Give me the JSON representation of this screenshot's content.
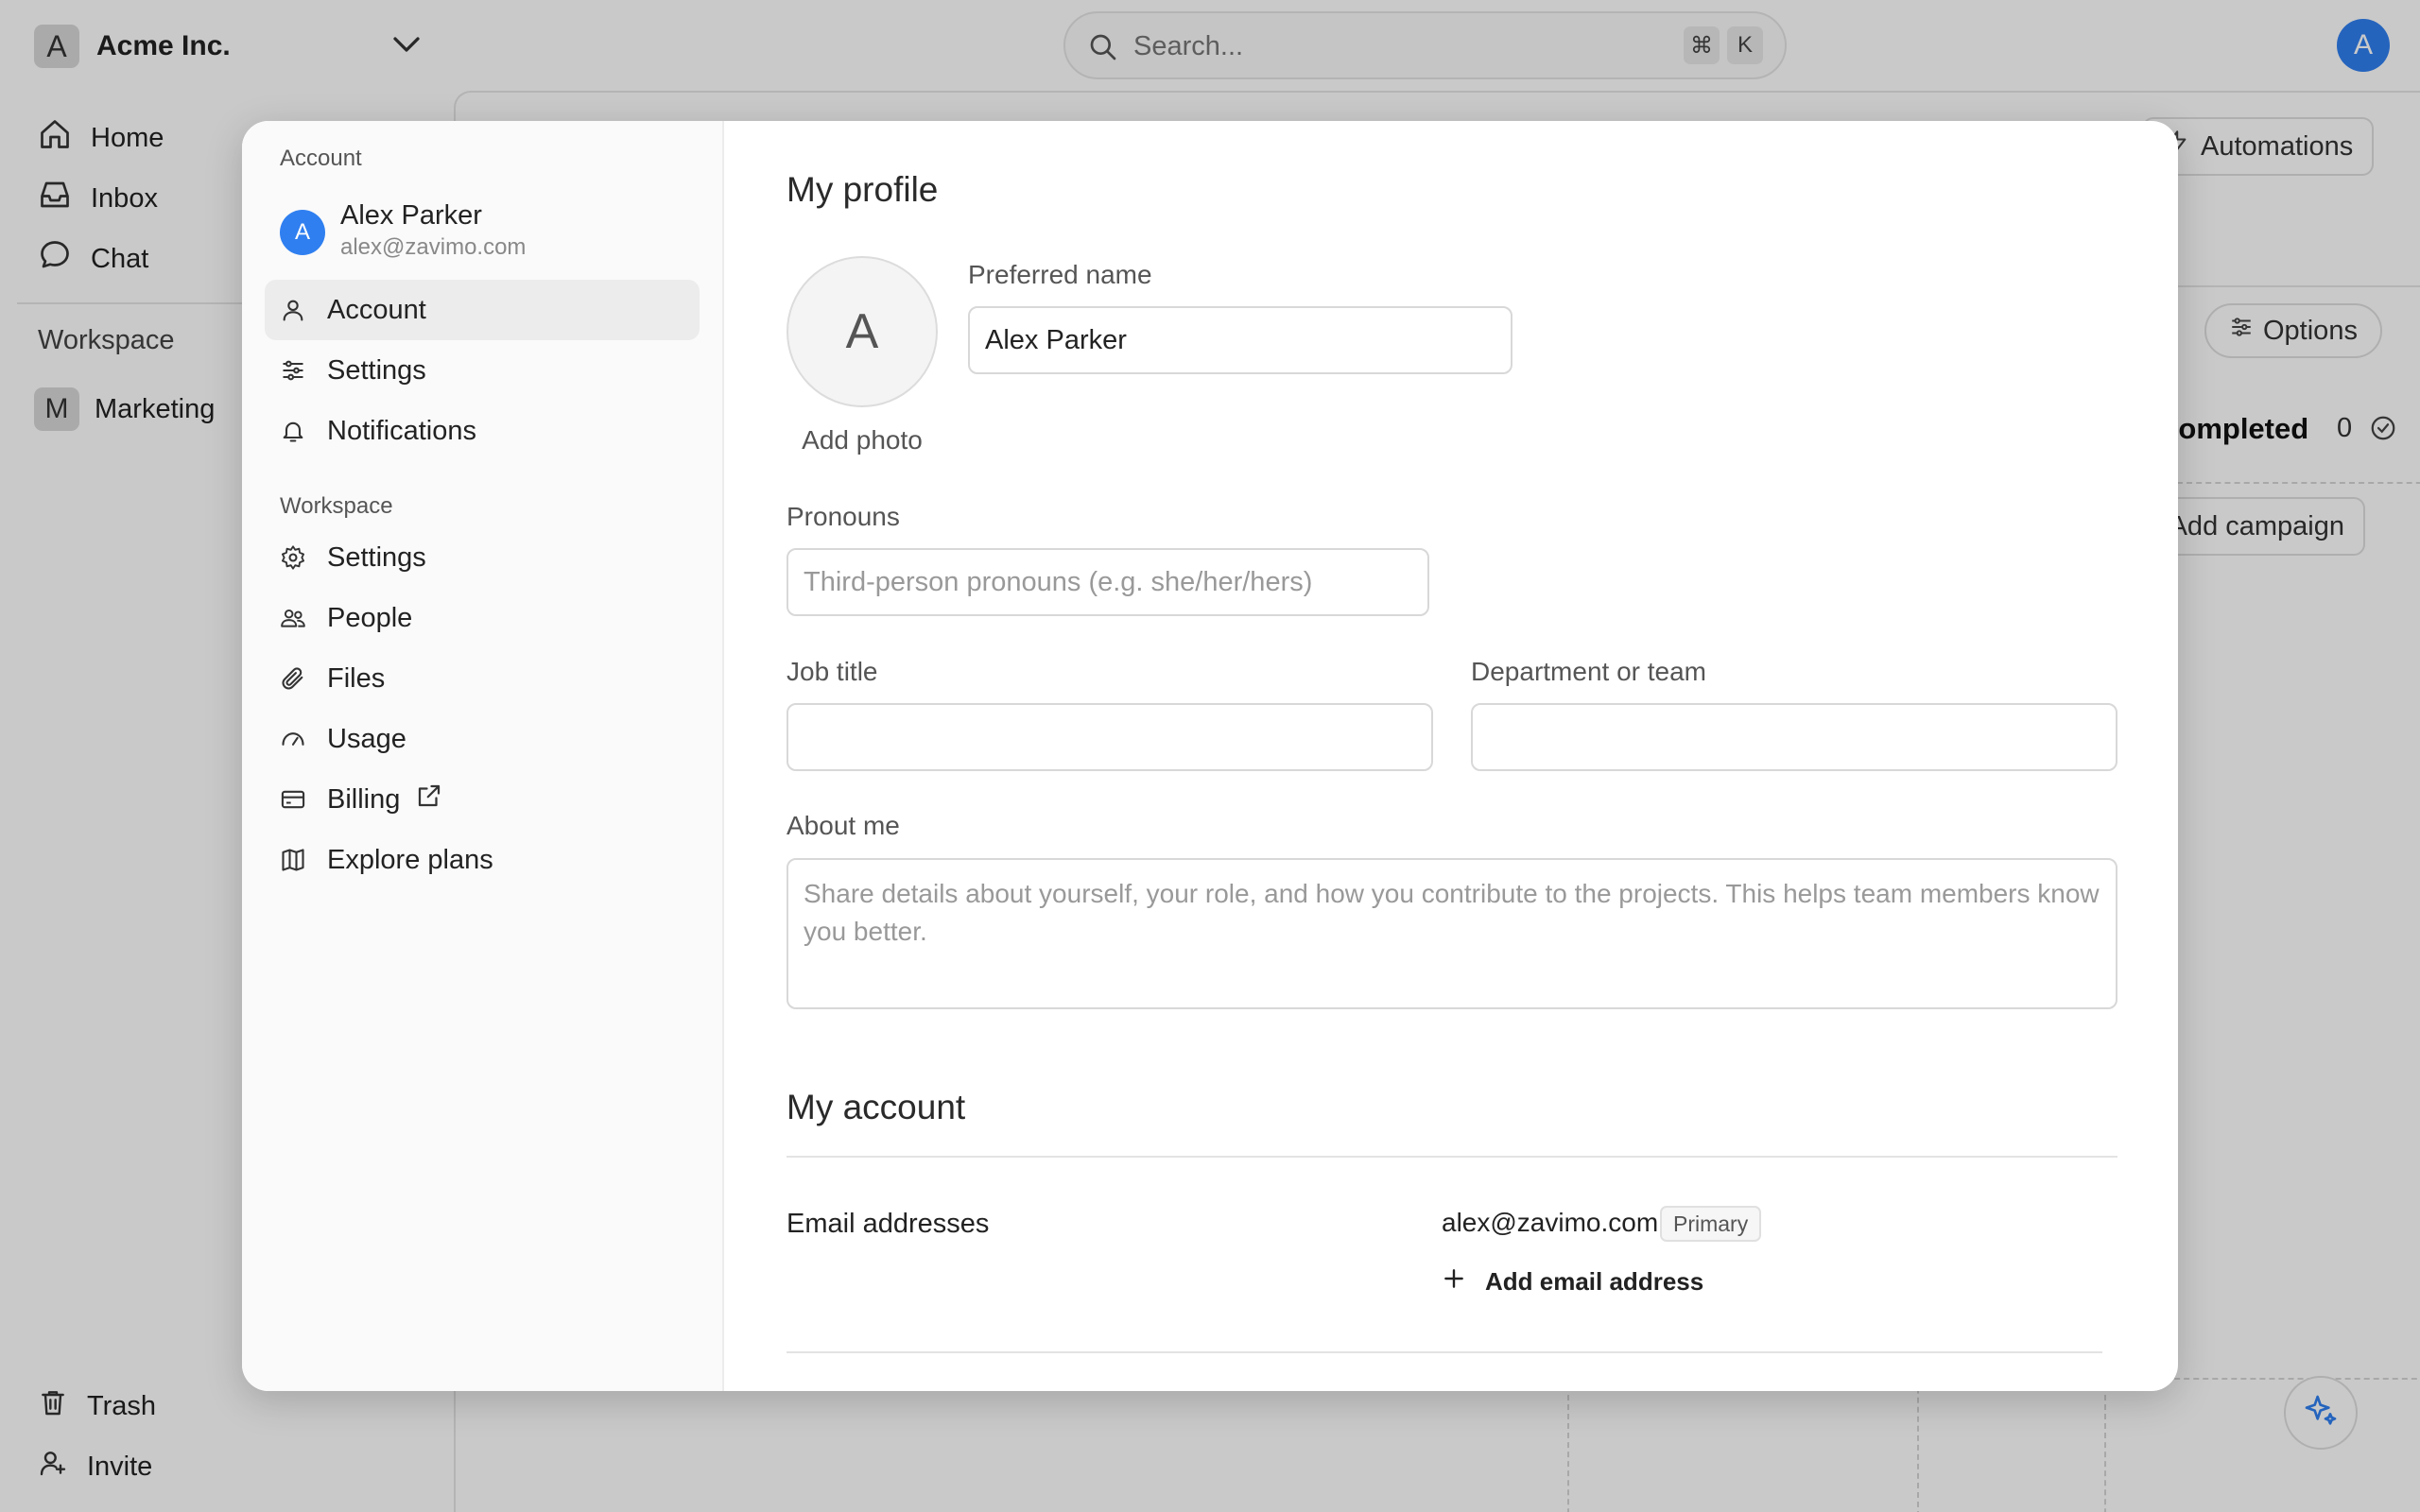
{
  "app": {
    "org_initial": "A",
    "org_name": "Acme Inc.",
    "search_placeholder": "Search...",
    "shortcut_keys": [
      "⌘",
      "K"
    ],
    "user_initial": "A",
    "nav": {
      "items": [
        {
          "label": "Home",
          "icon": "home-icon"
        },
        {
          "label": "Inbox",
          "icon": "inbox-icon"
        },
        {
          "label": "Chat",
          "icon": "chat-icon"
        }
      ],
      "workspace_label": "Workspace",
      "workspace_item": {
        "initial": "M",
        "label": "Marketing"
      },
      "bottom_items": [
        {
          "label": "Trash",
          "icon": "trash-icon"
        },
        {
          "label": "Invite",
          "icon": "add-user-icon"
        }
      ]
    },
    "main": {
      "automations_label": "Automations",
      "options_label": "Options",
      "completed_label": "Completed",
      "completed_count": "0",
      "add_campaign_label": "Add campaign"
    },
    "accent_color": "#2f7ff0"
  },
  "modal": {
    "sidebar": {
      "account_section": "Account",
      "user": {
        "initial": "A",
        "name": "Alex Parker",
        "email": "alex@zavimo.com"
      },
      "account_items": [
        {
          "label": "Account",
          "icon": "user-icon",
          "active": true
        },
        {
          "label": "Settings",
          "icon": "sliders-icon"
        },
        {
          "label": "Notifications",
          "icon": "bell-icon"
        }
      ],
      "workspace_section": "Workspace",
      "workspace_items": [
        {
          "label": "Settings",
          "icon": "gear-icon"
        },
        {
          "label": "People",
          "icon": "people-icon"
        },
        {
          "label": "Files",
          "icon": "paperclip-icon"
        },
        {
          "label": "Usage",
          "icon": "gauge-icon"
        },
        {
          "label": "Billing",
          "icon": "credit-card-icon",
          "external": true
        },
        {
          "label": "Explore plans",
          "icon": "map-icon"
        }
      ]
    },
    "profile": {
      "title": "My profile",
      "photo_initial": "A",
      "add_photo": "Add photo",
      "preferred_name_label": "Preferred name",
      "preferred_name_value": "Alex Parker",
      "pronouns_label": "Pronouns",
      "pronouns_placeholder": "Third-person pronouns (e.g. she/her/hers)",
      "job_title_label": "Job title",
      "job_title_value": "",
      "department_label": "Department or team",
      "department_value": "",
      "about_label": "About me",
      "about_placeholder": "Share details about yourself, your role, and how you contribute to the projects. This helps team members know you better."
    },
    "account": {
      "title": "My account",
      "emails_label": "Email addresses",
      "email": "alex@zavimo.com",
      "primary_badge": "Primary",
      "add_email": "Add email address"
    }
  }
}
